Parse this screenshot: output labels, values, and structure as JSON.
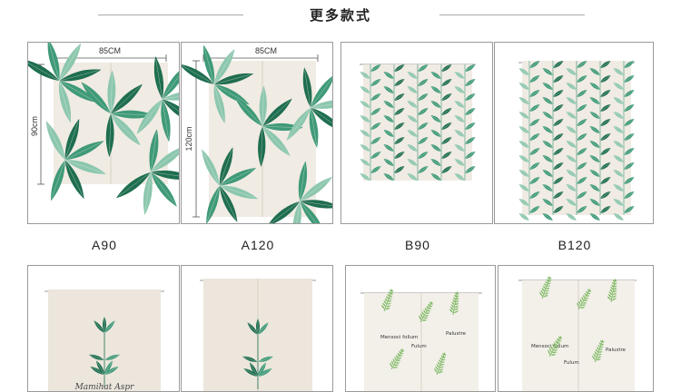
{
  "header": {
    "title": "更多款式"
  },
  "products": [
    {
      "code": "A90",
      "width_label": "85CM",
      "height_label": "90cm",
      "pattern": "large-leaves"
    },
    {
      "code": "A120",
      "width_label": "85CM",
      "height_label": "120cm",
      "pattern": "large-leaves"
    },
    {
      "code": "B90",
      "pattern": "vine-leaves"
    },
    {
      "code": "B120",
      "pattern": "vine-leaves"
    }
  ],
  "second_row": [
    {
      "pattern": "single-sprig",
      "script_text": "Mamihat Aspr"
    },
    {
      "pattern": "single-sprig"
    },
    {
      "pattern": "fern-labels",
      "labels": [
        "Mensoci folium",
        "Fulum",
        "Palustre"
      ]
    },
    {
      "pattern": "fern-labels",
      "labels": [
        "Mensoci folium",
        "Fulum",
        "Palustre"
      ]
    }
  ],
  "colors": {
    "leaf_dark": "#1f6e50",
    "leaf_mid": "#3f9a78",
    "leaf_light": "#8cc7ae",
    "fabric": "#f0ebe3",
    "fern": "#55a530"
  }
}
